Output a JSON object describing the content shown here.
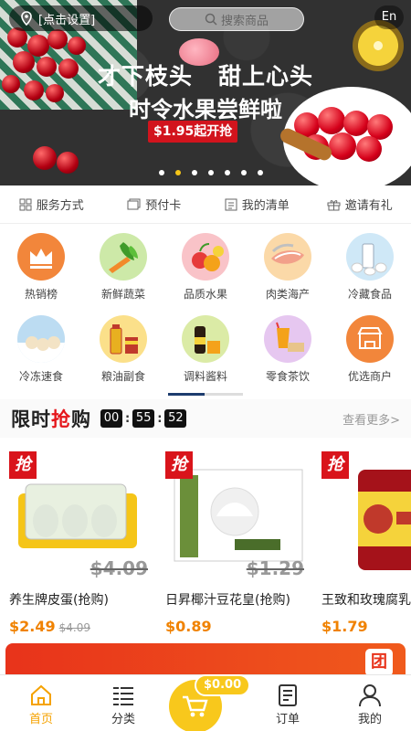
{
  "header": {
    "location_label": "[点击设置]",
    "search_placeholder": "搜索商品",
    "language": "En"
  },
  "banner": {
    "line1_left": "才下枝头",
    "line1_right": "甜上心头",
    "line2": "时令水果尝鲜啦",
    "price_tag": "$1.95起开抢",
    "slides": 7,
    "active_slide": 2
  },
  "services": [
    {
      "label": "服务方式",
      "icon": "grid-icon"
    },
    {
      "label": "预付卡",
      "icon": "card-icon"
    },
    {
      "label": "我的清单",
      "icon": "list-icon"
    },
    {
      "label": "邀请有礼",
      "icon": "gift-icon"
    }
  ],
  "categories": [
    {
      "label": "热销榜",
      "icon": "crown-icon",
      "color": "#f2863b"
    },
    {
      "label": "新鲜蔬菜",
      "icon": "vegetable-icon",
      "color": "#8fd05b"
    },
    {
      "label": "品质水果",
      "icon": "fruit-icon",
      "color": "#f7a0a8"
    },
    {
      "label": "肉类海产",
      "icon": "meat-icon",
      "color": "#f5c080"
    },
    {
      "label": "冷藏食品",
      "icon": "milk-icon",
      "color": "#9dd0f0"
    },
    {
      "label": "冷冻速食",
      "icon": "frozen-food-icon",
      "color": "#8fc3e6"
    },
    {
      "label": "粮油副食",
      "icon": "oil-icon",
      "color": "#f7c850"
    },
    {
      "label": "调料酱料",
      "icon": "sauce-icon",
      "color": "#c9e07a"
    },
    {
      "label": "零食茶饮",
      "icon": "snack-icon",
      "color": "#d9a8e8"
    },
    {
      "label": "优选商户",
      "icon": "shop-icon",
      "color": "#f2863b"
    }
  ],
  "flash_sale": {
    "title_a": "限时",
    "title_b": "抢",
    "title_c": "购",
    "timer": [
      "00",
      "55",
      "52"
    ],
    "more": "查看更多>",
    "badge": "抢",
    "products": [
      {
        "name": "养生牌皮蛋(抢购)",
        "price": "$2.49",
        "old_price": "$4.09",
        "strike_price": "$4.09"
      },
      {
        "name": "日昇椰汁豆花皇(抢购)",
        "price": "$0.89",
        "old_price": "",
        "strike_price": "$1.29"
      },
      {
        "name": "王致和玫瑰腐乳",
        "price": "$1.79",
        "old_price": "",
        "strike_price": ""
      }
    ]
  },
  "promo": {
    "logo": "团"
  },
  "cart": {
    "amount": "$0.00"
  },
  "tabbar": [
    {
      "label": "首页",
      "icon": "home-icon",
      "active": true
    },
    {
      "label": "分类",
      "icon": "category-list-icon",
      "active": false
    },
    {
      "label": "订单",
      "icon": "order-icon",
      "active": false
    },
    {
      "label": "我的",
      "icon": "user-icon",
      "active": false
    }
  ]
}
